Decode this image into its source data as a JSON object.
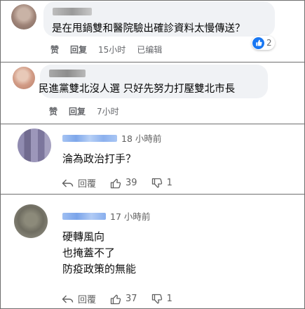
{
  "facebook_comments": [
    {
      "text": "是在甩鍋雙和醫院驗出確診資料太慢傳送？",
      "actions": {
        "like": "赞",
        "reply": "回复"
      },
      "time": "15小时",
      "edited": "已编辑",
      "reaction_count": "2",
      "reaction_icon": "thumbs-up-icon",
      "colors": {
        "bubble": "#f0f2f5",
        "reaction": "#1877f2"
      }
    },
    {
      "text": "民進黨雙北沒人選 只好先努力打壓雙北市長",
      "actions": {
        "like": "赞",
        "reply": "回复"
      },
      "time": "7小时"
    }
  ],
  "youtube_comments": [
    {
      "time": "18 小時前",
      "lines": [
        "淪為政治打手？"
      ],
      "actions": {
        "reply": "回覆",
        "like_count": "39",
        "dislike_count": "1"
      }
    },
    {
      "time": "17 小時前",
      "lines": [
        "硬轉風向",
        "也掩蓋不了",
        "防疫政策的無能"
      ],
      "actions": {
        "reply": "回覆",
        "like_count": "37",
        "dislike_count": "1"
      }
    }
  ],
  "accent": {
    "name_blur": "#8fb4ef",
    "name_blur_fb": "#b8b8b8"
  }
}
